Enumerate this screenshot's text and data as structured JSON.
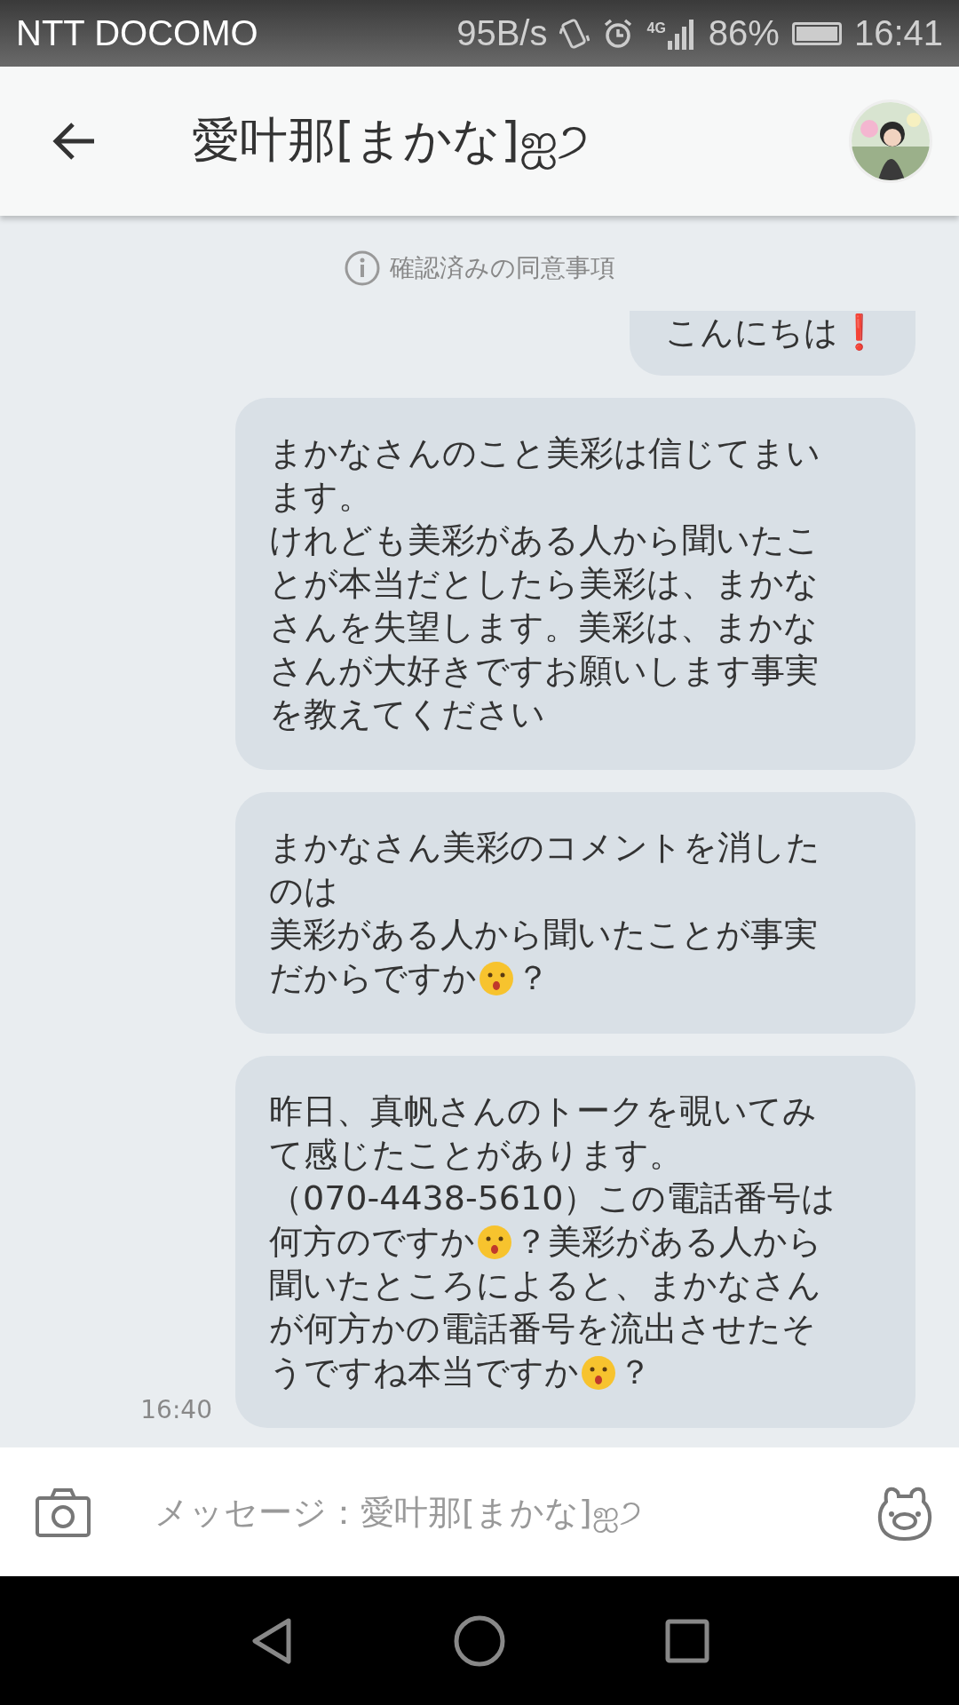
{
  "status_bar": {
    "carrier": "NTT DOCOMO",
    "speed": "95B/s",
    "network": "4G",
    "battery": "86%",
    "time": "16:41"
  },
  "header": {
    "title": "愛叶那[まかな]ஐ੭"
  },
  "notice": "確認済みの同意事項",
  "messages": [
    {
      "cut": true,
      "lines": [
        [
          {
            "kind": "text",
            "text": "こんにちは❗"
          }
        ]
      ]
    },
    {
      "cut": false,
      "lines": [
        [
          {
            "kind": "text",
            "text": "まかなさんのこと美彩は信じてまい"
          }
        ],
        [
          {
            "kind": "text",
            "text": "ます。"
          }
        ],
        [
          {
            "kind": "text",
            "text": "けれども美彩がある人から聞いたこ"
          }
        ],
        [
          {
            "kind": "text",
            "text": "とが本当だとしたら美彩は、まかな"
          }
        ],
        [
          {
            "kind": "text",
            "text": "さんを失望します。美彩は、まかな"
          }
        ],
        [
          {
            "kind": "text",
            "text": "さんが大好きですお願いします事実"
          }
        ],
        [
          {
            "kind": "text",
            "text": "を教えてください"
          }
        ]
      ]
    },
    {
      "cut": false,
      "lines": [
        [
          {
            "kind": "text",
            "text": "まかなさん美彩のコメントを消した"
          }
        ],
        [
          {
            "kind": "text",
            "text": "のは"
          }
        ],
        [
          {
            "kind": "text",
            "text": "美彩がある人から聞いたことが事実"
          }
        ],
        [
          {
            "kind": "text",
            "text": "だからですか"
          },
          {
            "kind": "emoji"
          },
          {
            "kind": "text",
            "text": "？"
          }
        ]
      ]
    },
    {
      "cut": false,
      "time": "16:40",
      "lines": [
        [
          {
            "kind": "text",
            "text": "昨日、真帆さんのトークを覗いてみ"
          }
        ],
        [
          {
            "kind": "text",
            "text": "て感じたことがあります。"
          }
        ],
        [
          {
            "kind": "text",
            "text": "（070-4438-5610）この電話番号は"
          }
        ],
        [
          {
            "kind": "text",
            "text": "何方のですか"
          },
          {
            "kind": "emoji"
          },
          {
            "kind": "text",
            "text": "？美彩がある人から"
          }
        ],
        [
          {
            "kind": "text",
            "text": "聞いたところによると、まかなさん"
          }
        ],
        [
          {
            "kind": "text",
            "text": "が何方かの電話番号を流出させたそ"
          }
        ],
        [
          {
            "kind": "text",
            "text": "うですね本当ですか"
          },
          {
            "kind": "emoji"
          },
          {
            "kind": "text",
            "text": "？"
          }
        ]
      ]
    }
  ],
  "input": {
    "placeholder": "メッセージ：愛叶那[まかな]ஐ੭"
  }
}
